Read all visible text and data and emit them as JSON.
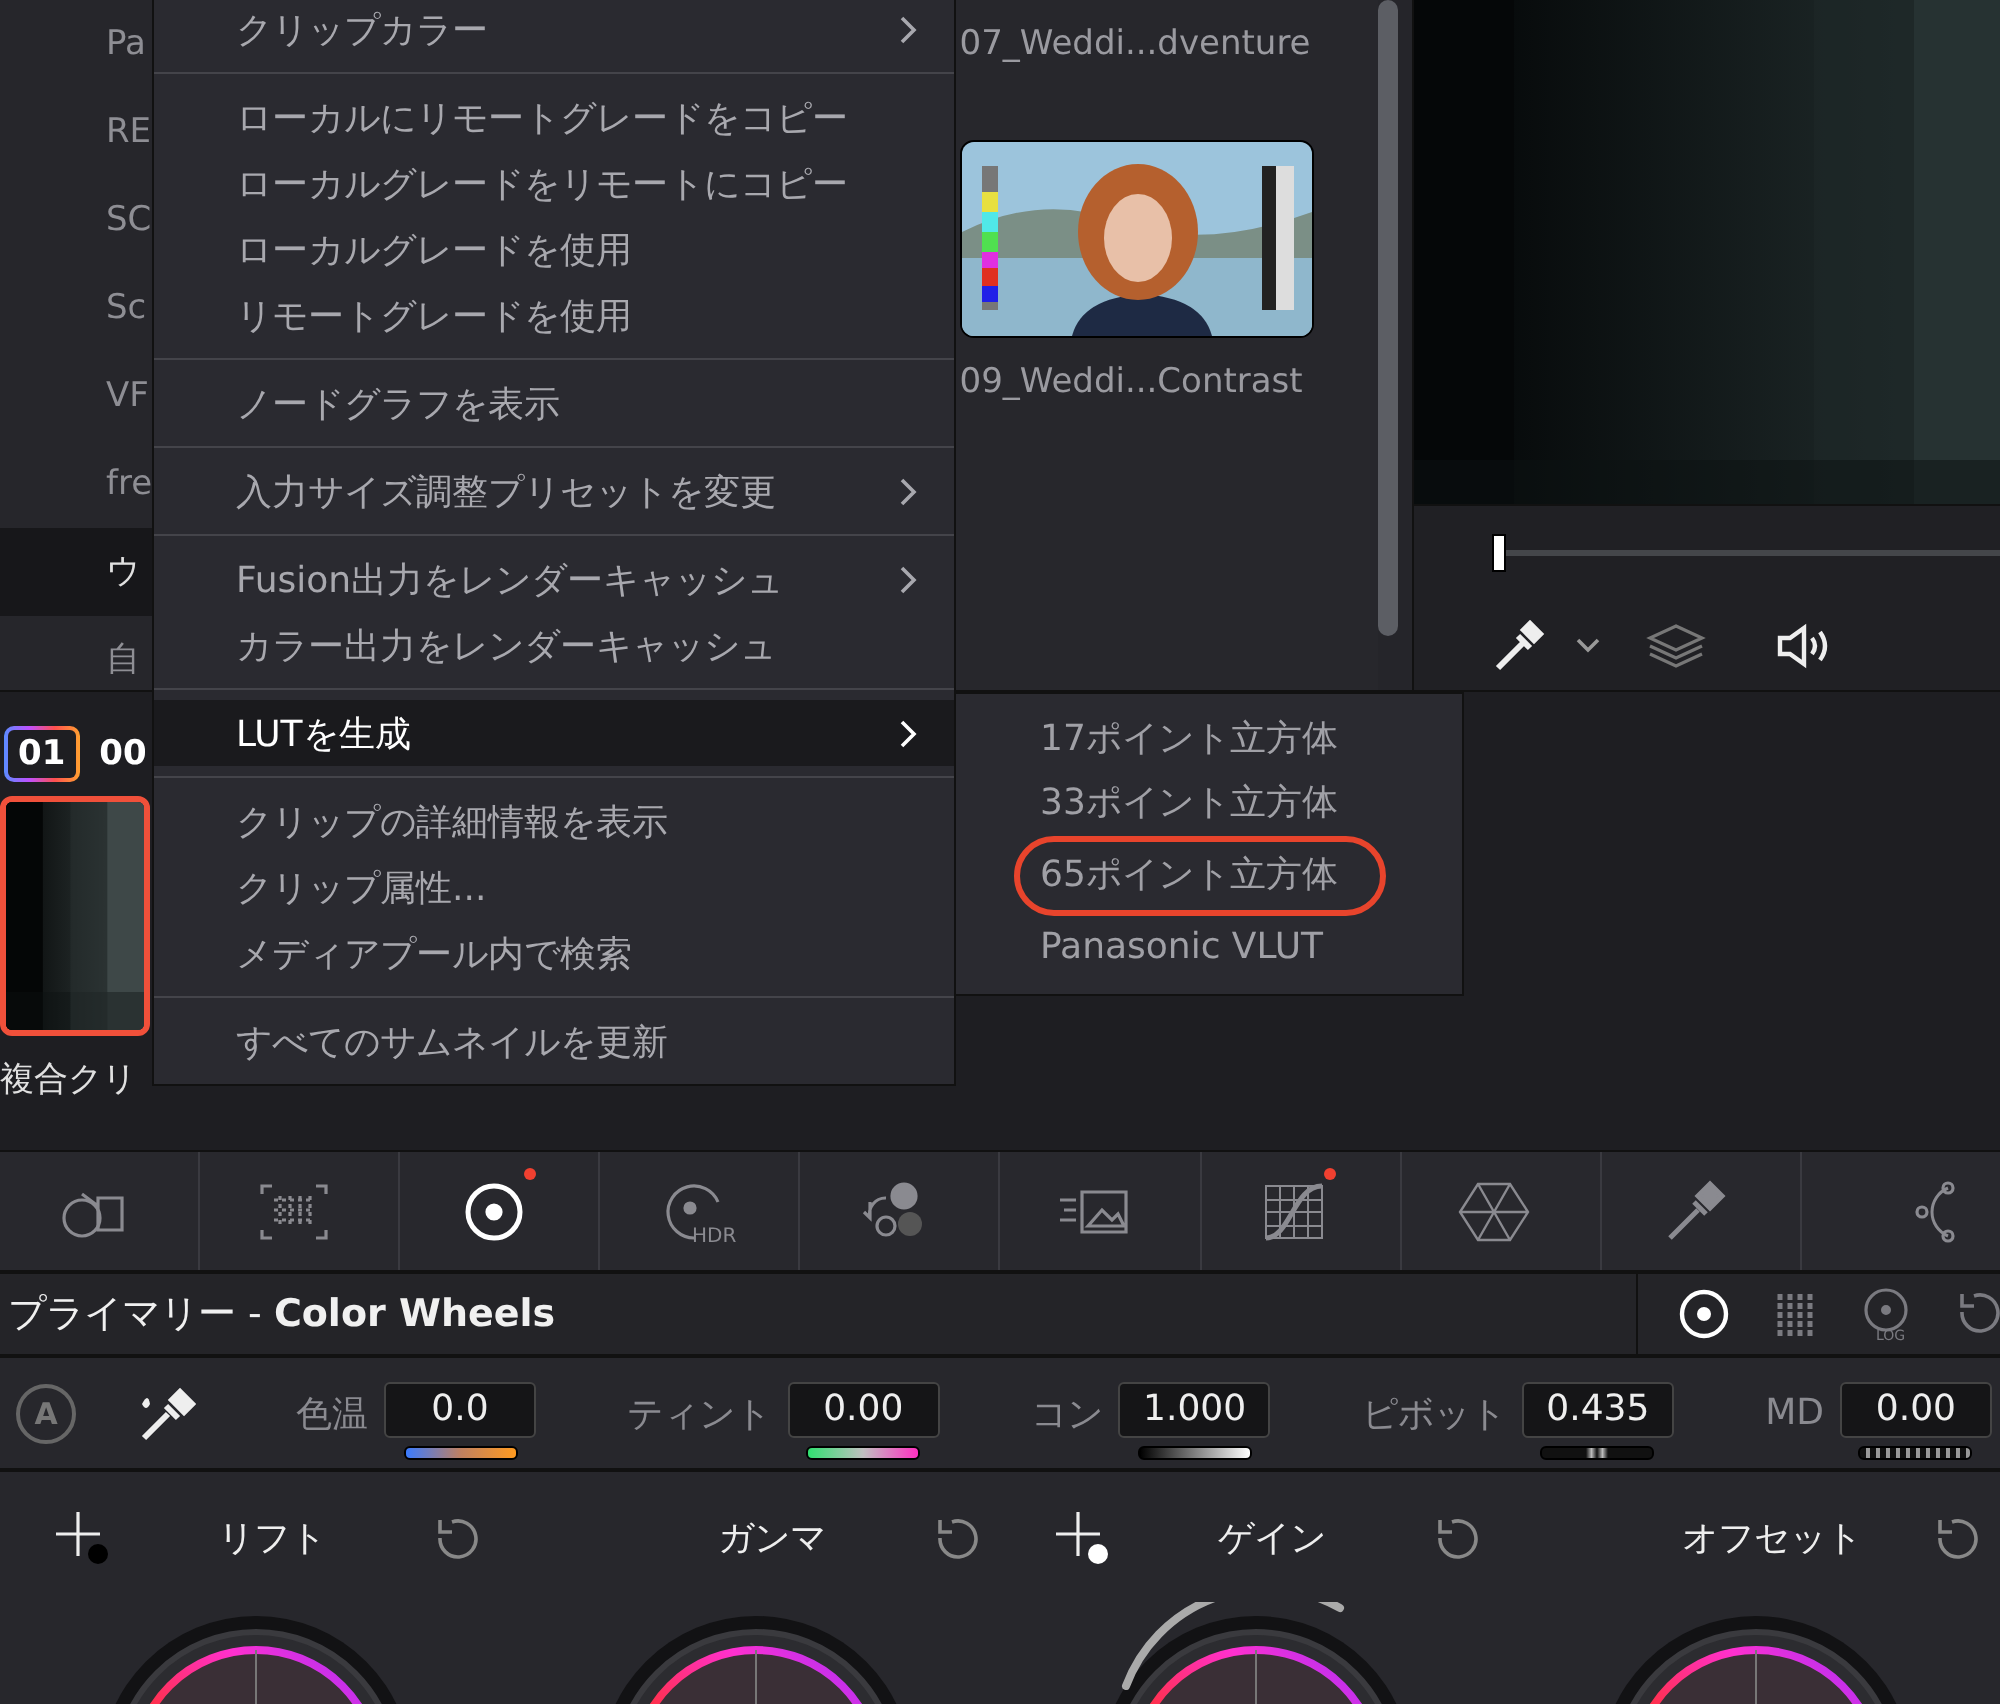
{
  "bins": [
    {
      "label": "Pa",
      "selected": false
    },
    {
      "label": "RE",
      "selected": false
    },
    {
      "label": "SC",
      "selected": false
    },
    {
      "label": "Sc",
      "selected": false
    },
    {
      "label": "VF",
      "selected": false
    },
    {
      "label": "fre",
      "selected": false
    },
    {
      "label": "ウ",
      "selected": true
    },
    {
      "label": "自",
      "selected": false
    }
  ],
  "clips": [
    {
      "label": "07_Weddi...dventure"
    },
    {
      "label": "09_Weddi...Contrast",
      "kind": "picture"
    }
  ],
  "viewer": {
    "kind": "picture",
    "playhead": {
      "level": 0
    }
  },
  "timeline": {
    "clip_number": "01",
    "timecode": "00",
    "clip_name": "複合クリ",
    "selected": true
  },
  "context_menu": {
    "groups": [
      [
        {
          "label": "クリップカラー",
          "submenu": true,
          "highlighted": false
        }
      ],
      [
        {
          "label": "ローカルにリモートグレードをコピー",
          "submenu": false,
          "highlighted": false
        },
        {
          "label": "ローカルグレードをリモートにコピー",
          "submenu": false,
          "highlighted": false
        },
        {
          "label": "ローカルグレードを使用",
          "submenu": false,
          "highlighted": false
        },
        {
          "label": "リモートグレードを使用",
          "submenu": false,
          "highlighted": false
        }
      ],
      [
        {
          "label": "ノードグラフを表示",
          "submenu": false,
          "highlighted": false
        }
      ],
      [
        {
          "label": "入力サイズ調整プリセットを変更",
          "submenu": true,
          "highlighted": false
        }
      ],
      [
        {
          "label": "Fusion出力をレンダーキャッシュ",
          "submenu": true,
          "highlighted": false
        },
        {
          "label": "カラー出力をレンダーキャッシュ",
          "submenu": false,
          "highlighted": false
        }
      ],
      [
        {
          "label": "LUTを生成",
          "submenu": true,
          "highlighted": true
        }
      ],
      [
        {
          "label": "クリップの詳細情報を表示",
          "submenu": false,
          "highlighted": false
        },
        {
          "label": "クリップ属性...",
          "submenu": false,
          "highlighted": false
        },
        {
          "label": "メディアプール内で検索",
          "submenu": false,
          "highlighted": false
        }
      ],
      [
        {
          "label": "すべてのサムネイルを更新",
          "submenu": false,
          "highlighted": false
        }
      ]
    ]
  },
  "submenu": {
    "items": [
      {
        "label": "17ポイント立方体",
        "circled": false
      },
      {
        "label": "33ポイント立方体",
        "circled": false
      },
      {
        "label": "65ポイント立方体",
        "circled": true
      },
      {
        "label": "Panasonic VLUT",
        "circled": false
      }
    ]
  },
  "toolbar": [
    {
      "kind": "camera",
      "selected": false,
      "modified": false
    },
    {
      "kind": "grid",
      "selected": false,
      "modified": false
    },
    {
      "kind": "wheel",
      "selected": true,
      "modified": true
    },
    {
      "kind": "hdr",
      "label": "HDR",
      "selected": false,
      "modified": false
    },
    {
      "kind": "mixer",
      "selected": false,
      "modified": false
    },
    {
      "kind": "motion",
      "selected": false,
      "modified": false
    },
    {
      "kind": "curves",
      "selected": false,
      "modified": true
    },
    {
      "kind": "warper",
      "selected": false,
      "modified": false
    },
    {
      "kind": "qualifier",
      "selected": false,
      "modified": false
    },
    {
      "kind": "window",
      "selected": false,
      "modified": false
    }
  ],
  "panel": {
    "title": "プライマリー - **Color Wheels**",
    "modes": [
      {
        "kind": "wheels",
        "selected": true
      },
      {
        "kind": "bars",
        "selected": false
      },
      {
        "kind": "log",
        "label": "LOG",
        "selected": false
      },
      {
        "kind": "reset",
        "selected": false
      }
    ]
  },
  "auto_button": "A",
  "adjustments": [
    {
      "label": "色温",
      "value": "0.0",
      "kind": "temp"
    },
    {
      "label": "ティント",
      "value": "0.00",
      "kind": "tint"
    },
    {
      "label": "コン",
      "value": "1.000",
      "kind": "contrast"
    },
    {
      "label": "ピボット",
      "value": "0.435",
      "kind": "pivot"
    },
    {
      "label": "MD",
      "value": "0.00",
      "kind": "md"
    }
  ],
  "wheels": [
    {
      "label": "リフト",
      "picker": true,
      "color": "#000000",
      "adjusted": false
    },
    {
      "label": "ガンマ",
      "picker": false,
      "adjusted": false
    },
    {
      "label": "ゲイン",
      "picker": true,
      "color": "#ffffff",
      "adjusted": true
    },
    {
      "label": "オフセット",
      "picker": false,
      "adjusted": false
    }
  ]
}
